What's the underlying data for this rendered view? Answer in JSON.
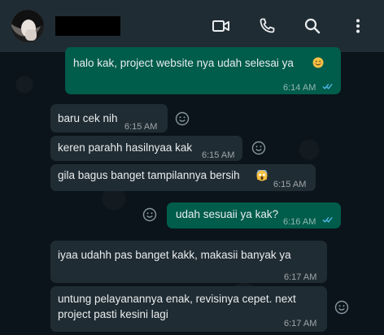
{
  "header": {
    "contact_name": "",
    "icons": [
      "video-call-icon",
      "voice-call-icon",
      "search-icon",
      "menu-icon"
    ]
  },
  "messages": [
    {
      "dir": "out",
      "text": "halo kak, project website nya udah selesai ya",
      "emoji": "smiling-face-emoji",
      "time": "6:14 AM",
      "status": "read"
    },
    {
      "dir": "in",
      "text": "baru cek nih",
      "time": "6:15 AM"
    },
    {
      "dir": "in",
      "text": "keren parahh hasilnyaa kak",
      "time": "6:15 AM"
    },
    {
      "dir": "in",
      "text": "gila bagus banget tampilannya bersih",
      "emoji": "screaming-face-emoji",
      "time": "6:15 AM"
    },
    {
      "dir": "out",
      "text": "udah sesuaii ya kak?",
      "time": "6:16 AM",
      "status": "read"
    },
    {
      "dir": "in",
      "text": "iyaa udahh pas banget kakk, makasii banyak ya",
      "time": "6:17 AM"
    },
    {
      "dir": "in",
      "text_line1": "untung pelayanannya enak, revisinya cepet. next",
      "text_line2": "project pasti kesini lagi",
      "time": "6:17 AM"
    }
  ],
  "colors": {
    "incoming_bubble": "#202c33",
    "outgoing_bubble": "#005c4b",
    "read_ticks": "#53bdeb",
    "background": "#0b141a",
    "header": "#202c33"
  }
}
